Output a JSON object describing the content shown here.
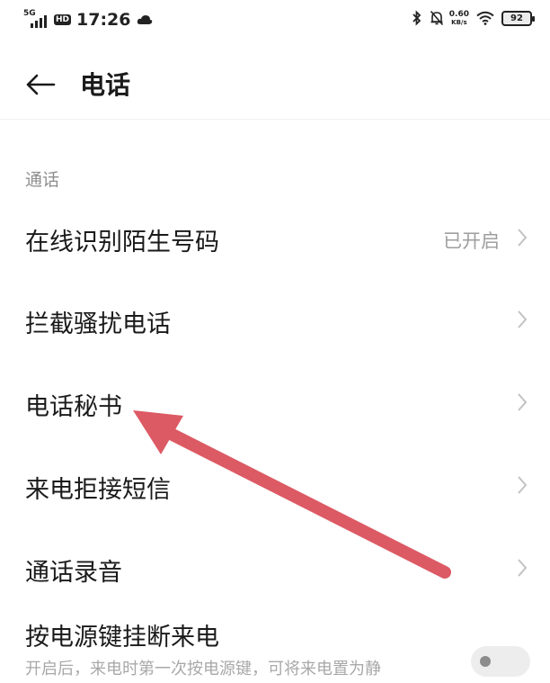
{
  "status_bar": {
    "network": "5G",
    "hd": "HD",
    "time": "17:26",
    "net_speed_value": "0.60",
    "net_speed_unit": "KB/s",
    "battery_level": "92",
    "icons": [
      "signal-icon",
      "weather-icon",
      "bluetooth-icon",
      "mute-icon",
      "wifi-icon",
      "battery-icon"
    ]
  },
  "header": {
    "back_icon": "arrow-left-icon",
    "title": "电话"
  },
  "section": {
    "label": "通话"
  },
  "items": [
    {
      "label": "在线识别陌生号码",
      "status": "已开启"
    },
    {
      "label": "拦截骚扰电话"
    },
    {
      "label": "电话秘书"
    },
    {
      "label": "来电拒接短信"
    },
    {
      "label": "通话录音"
    }
  ],
  "toggle_item": {
    "label": "按电源键挂断来电",
    "description": "开启后，来电时第一次按电源键，可将来电置为静",
    "enabled": false
  },
  "colors": {
    "annotation_arrow": "#dc5a64",
    "text_primary": "#1a1a1a",
    "text_secondary": "#9e9e9e"
  }
}
